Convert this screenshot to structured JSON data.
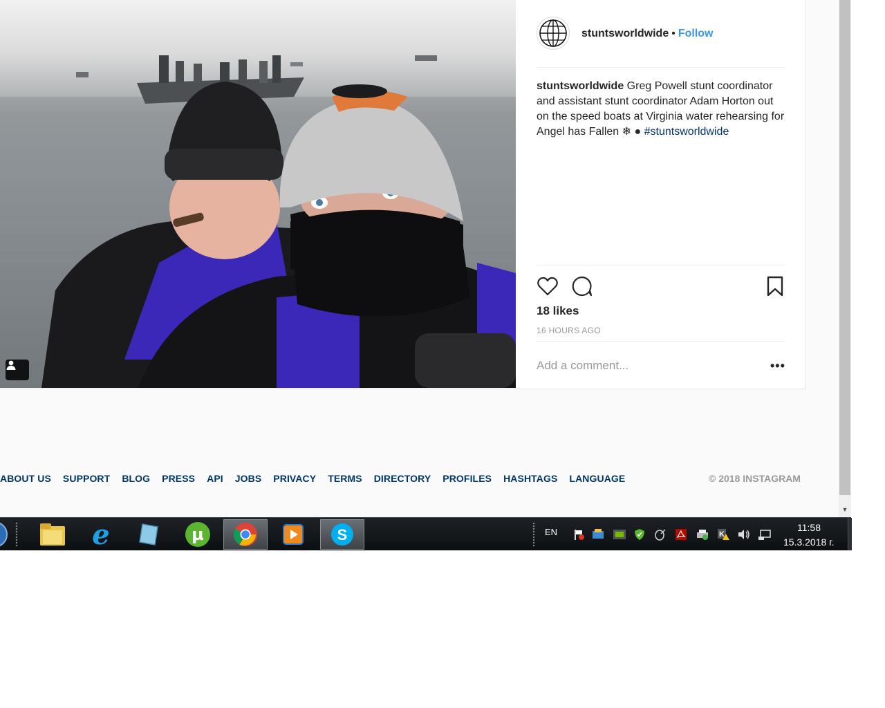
{
  "post": {
    "username": "stuntsworldwide",
    "separator": "•",
    "follow_label": "Follow",
    "caption_user": "stuntsworldwide",
    "caption_text": " Greg Powell stunt coordinator and assistant stunt coordinator Adam Horton out on the speed boats at Virginia water rehearsing for Angel has Fallen ❄ ",
    "hashtag": "#stuntsworldwide",
    "likes": "18 likes",
    "time": "16 HOURS AGO",
    "comment_placeholder": "Add a comment...",
    "more_label": "•••"
  },
  "footer": {
    "links": [
      "ABOUT US",
      "SUPPORT",
      "BLOG",
      "PRESS",
      "API",
      "JOBS",
      "PRIVACY",
      "TERMS",
      "DIRECTORY",
      "PROFILES",
      "HASHTAGS",
      "LANGUAGE"
    ],
    "copyright": "© 2018 INSTAGRAM"
  },
  "taskbar": {
    "apps": [
      "start-orb",
      "file-explorer",
      "internet-explorer",
      "notepad",
      "utorrent",
      "chrome",
      "media-player",
      "skype"
    ],
    "active_app": "chrome",
    "language": "EN",
    "time": "11:58",
    "date": "15.3.2018 г."
  },
  "colors": {
    "link_blue": "#3897f0",
    "footer_link": "#003569",
    "text": "#262626",
    "muted": "#999999"
  }
}
